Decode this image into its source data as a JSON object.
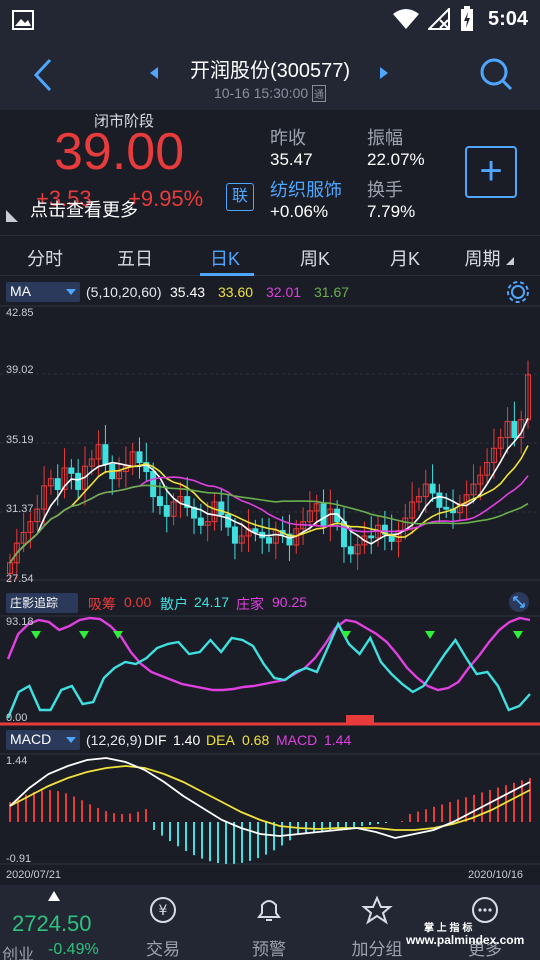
{
  "status_bar": {
    "time": "5:04"
  },
  "header": {
    "title": "开润股份(300577)",
    "datetime": "10-16 15:30:00",
    "datetime_badge": "通"
  },
  "quote": {
    "phase": "闭市阶段",
    "price": "39.00",
    "change": "+3.53",
    "change_pct": "+9.95%",
    "more_hint": "点击查看更多",
    "link_badge": "联",
    "prev_close_label": "昨收",
    "prev_close_value": "35.47",
    "amplitude_label": "振幅",
    "amplitude_value": "22.07%",
    "sector_label": "纺织服饰",
    "sector_value": "+0.06%",
    "turnover_label": "换手",
    "turnover_value": "7.79%",
    "add_symbol": "+"
  },
  "tabs": [
    {
      "label": "分时"
    },
    {
      "label": "五日"
    },
    {
      "label": "日K"
    },
    {
      "label": "周K"
    },
    {
      "label": "月K"
    },
    {
      "label": "周期"
    }
  ],
  "ma_bar": {
    "name": "MA",
    "params": "(5,10,20,60)",
    "ma5": "35.43",
    "ma10": "33.60",
    "ma20": "32.01",
    "ma60": "31.67",
    "colors": {
      "ma5": "#ffffff",
      "ma10": "#f0e23a",
      "ma20": "#e040e0",
      "ma60": "#6ab04c"
    }
  },
  "price_axis": {
    "top": "42.85",
    "mid1": "39.02",
    "mid2": "35.19",
    "mid3": "31.37",
    "bottom": "27.54"
  },
  "zy_bar": {
    "name": "庄影追踪",
    "xichou_label": "吸筹",
    "xichou_value": "0.00",
    "sanhu_label": "散户",
    "sanhu_value": "24.17",
    "zhuangjia_label": "庄家",
    "zhuangjia_value": "90.25"
  },
  "zy_axis": {
    "top": "93.18",
    "bottom": "0.00"
  },
  "macd_bar": {
    "name": "MACD",
    "params": "(12,26,9)",
    "dif_label": "DIF",
    "dif_value": "1.40",
    "dea_label": "DEA",
    "dea_value": "0.68",
    "macd_label": "MACD",
    "macd_value": "1.44"
  },
  "macd_axis": {
    "top": "1.44",
    "bottom": "-0.91"
  },
  "date_axis": {
    "start": "2020/07/21",
    "end": "2020/10/16"
  },
  "bottom_nav": {
    "index_value": "2724.50",
    "index_name": "创业",
    "index_change": "-0.49%",
    "items": [
      {
        "label": "交易",
        "icon": "yen-exchange-icon"
      },
      {
        "label": "预警",
        "icon": "bell-icon"
      },
      {
        "label": "加分组",
        "icon": "star-icon"
      },
      {
        "label": "更多",
        "icon": "more-icon"
      }
    ]
  },
  "watermark": {
    "line1": "掌 上 指 标",
    "line2": "www.palmindex.com"
  },
  "chart_data": {
    "type": "candlestick",
    "ylim": [
      27.54,
      42.85
    ],
    "x": [
      "2020/07/21",
      "2020/10/16"
    ],
    "series": [
      {
        "name": "MA5",
        "value": 35.43
      },
      {
        "name": "MA10",
        "value": 33.6
      },
      {
        "name": "MA20",
        "value": 32.01
      },
      {
        "name": "MA60",
        "value": 31.67
      }
    ]
  }
}
